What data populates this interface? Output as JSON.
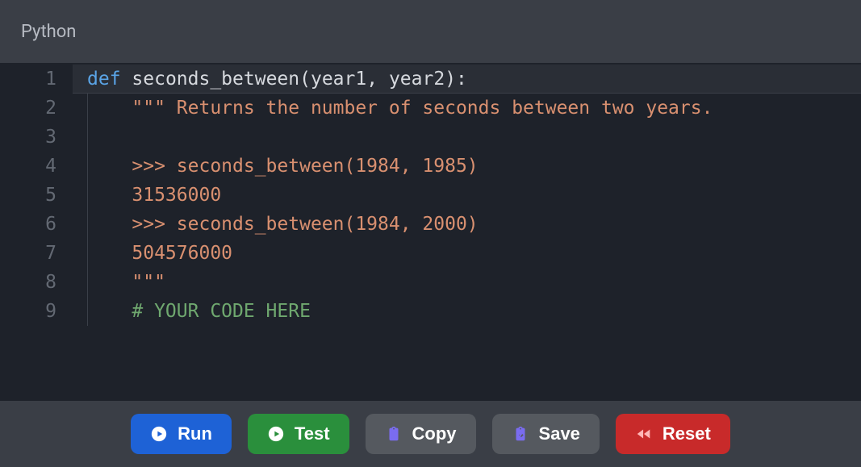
{
  "header": {
    "title": "Python"
  },
  "editor": {
    "line_count": 9,
    "lines": [
      {
        "num": 1,
        "tokens": [
          {
            "cls": "tok-keyword",
            "text": "def"
          },
          {
            "cls": "",
            "text": " "
          },
          {
            "cls": "tok-func",
            "text": "seconds_between"
          },
          {
            "cls": "tok-punc",
            "text": "("
          },
          {
            "cls": "tok-param",
            "text": "year1"
          },
          {
            "cls": "tok-punc",
            "text": ", "
          },
          {
            "cls": "tok-param",
            "text": "year2"
          },
          {
            "cls": "tok-punc",
            "text": "):"
          }
        ]
      },
      {
        "num": 2,
        "tokens": [
          {
            "cls": "",
            "text": "    "
          },
          {
            "cls": "tok-string",
            "text": "\"\"\" Returns the number of seconds between two years."
          }
        ]
      },
      {
        "num": 3,
        "tokens": [
          {
            "cls": "",
            "text": ""
          }
        ]
      },
      {
        "num": 4,
        "tokens": [
          {
            "cls": "",
            "text": "    "
          },
          {
            "cls": "tok-string",
            "text": ">>> seconds_between(1984, 1985)"
          }
        ]
      },
      {
        "num": 5,
        "tokens": [
          {
            "cls": "",
            "text": "    "
          },
          {
            "cls": "tok-string",
            "text": "31536000"
          }
        ]
      },
      {
        "num": 6,
        "tokens": [
          {
            "cls": "",
            "text": "    "
          },
          {
            "cls": "tok-string",
            "text": ">>> seconds_between(1984, 2000)"
          }
        ]
      },
      {
        "num": 7,
        "tokens": [
          {
            "cls": "",
            "text": "    "
          },
          {
            "cls": "tok-string",
            "text": "504576000"
          }
        ]
      },
      {
        "num": 8,
        "tokens": [
          {
            "cls": "",
            "text": "    "
          },
          {
            "cls": "tok-string",
            "text": "\"\"\""
          }
        ]
      },
      {
        "num": 9,
        "tokens": [
          {
            "cls": "",
            "text": "    "
          },
          {
            "cls": "tok-comment",
            "text": "# YOUR CODE HERE"
          }
        ]
      }
    ]
  },
  "toolbar": {
    "run": {
      "label": "Run"
    },
    "test": {
      "label": "Test"
    },
    "copy": {
      "label": "Copy"
    },
    "save": {
      "label": "Save"
    },
    "reset": {
      "label": "Reset"
    }
  }
}
